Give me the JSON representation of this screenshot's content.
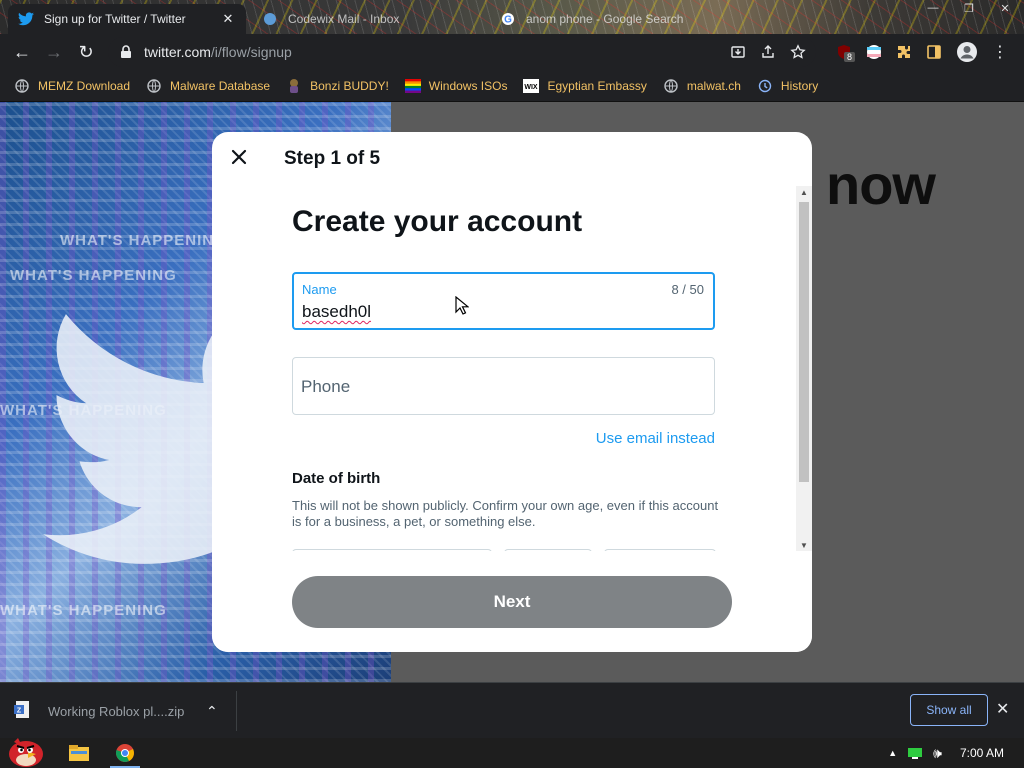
{
  "browser": {
    "tabs": [
      {
        "title": "Sign up for Twitter / Twitter",
        "active": true
      },
      {
        "title": "Codewix Mail - Inbox",
        "active": false
      },
      {
        "title": "anom phone - Google Search",
        "active": false
      }
    ],
    "url_host": "twitter.com",
    "url_path": "/i/flow/signup",
    "ext_badge": "8"
  },
  "bookmarks": [
    {
      "label": "MEMZ Download",
      "icon": "globe-icon"
    },
    {
      "label": "Malware Database",
      "icon": "globe-icon"
    },
    {
      "label": "Bonzi BUDDY!",
      "icon": "bonzi-icon"
    },
    {
      "label": "Windows ISOs",
      "icon": "windows-flag-icon"
    },
    {
      "label": "Egyptian Embassy",
      "icon": "wix-icon"
    },
    {
      "label": "malwat.ch",
      "icon": "globe-icon"
    },
    {
      "label": "History",
      "icon": "history-icon"
    }
  ],
  "background": {
    "partial_text": "now",
    "art_text": "WHAT'S HAPPENING"
  },
  "modal": {
    "step": "Step 1 of 5",
    "title": "Create your account",
    "name_field": {
      "label": "Name",
      "value": "basedh0l",
      "counter": "8 / 50"
    },
    "phone_field": {
      "placeholder": "Phone"
    },
    "use_email_link": "Use email instead",
    "dob_title": "Date of birth",
    "dob_description": "This will not be shown publicly. Confirm your own age, even if this account is for a business, a pet, or something else.",
    "next_button": "Next"
  },
  "downloads": {
    "file_name": "Working Roblox pl....zip",
    "show_all": "Show all"
  },
  "taskbar": {
    "time": "7:00 AM"
  },
  "colors": {
    "accent_blue": "#1d9bf0",
    "next_button_bg": "#7f8386",
    "bookmark_text": "#f2c265",
    "chrome_dark": "#202124"
  }
}
